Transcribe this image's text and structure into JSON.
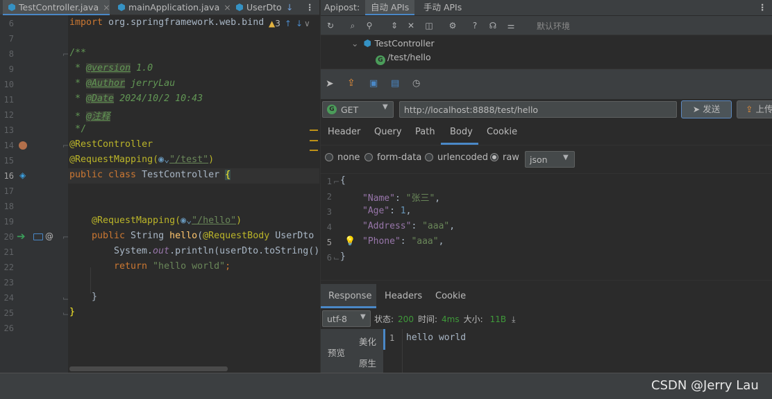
{
  "editor": {
    "tabs": [
      {
        "label": "TestController.java",
        "active": true,
        "closable": true
      },
      {
        "label": "mainApplication.java",
        "active": false,
        "closable": true
      },
      {
        "label": "UserDto",
        "active": false,
        "closable": false
      }
    ],
    "warning_count": "3",
    "line_numbers": [
      "6",
      "7",
      "8",
      "9",
      "10",
      "11",
      "12",
      "13",
      "14",
      "15",
      "16",
      "17",
      "18",
      "19",
      "20",
      "21",
      "22",
      "23",
      "24",
      "25",
      "26"
    ],
    "code": {
      "l6_kw": "import",
      "l6_rest": " org.springframework.web.bind",
      "l8": "/**",
      "l9_star": " * ",
      "l9_tag": "@version",
      "l9_val": " 1.0",
      "l10_tag": "@Author",
      "l10_val": " jerryLau",
      "l11_tag": "@Date",
      "l11_val": " 2024/10/2 10:43",
      "l12_tag": "@注释",
      "l13": " */",
      "l14": "@RestController",
      "l15_ann": "@RequestMapping(",
      "l15_str": "\"/test\"",
      "l15_end": ")",
      "l16_kw": "public class",
      "l16_name": " TestController ",
      "l16_brace": "{",
      "l19_ann": "@RequestMapping(",
      "l19_str": "\"/hello\"",
      "l19_end": ")",
      "l20_kw": "public",
      "l20_type": " String ",
      "l20_fn": "hello",
      "l20_p": "(",
      "l20_ann": "@RequestBody",
      "l20_rest": " UserDto",
      "l21_a": "System.",
      "l21_out": "out",
      "l21_b": ".println(userDto.toString()",
      "l22_kw": "return",
      "l22_str": " \"hello world\"",
      "l22_end": ";",
      "l24": "}",
      "l25": "}"
    }
  },
  "apipost": {
    "header_label": "Apipost:",
    "tabs": [
      "自动 APIs",
      "手动 APIs"
    ],
    "environment": "默认环境",
    "tree": {
      "controller": "TestController",
      "endpoint": "/test/hello",
      "endpoint_method_letter": "G"
    },
    "request": {
      "method": "GET",
      "url": "http://localhost:8888/test/hello",
      "send_label": "发送",
      "upload_label": "上传"
    },
    "param_tabs": [
      "Header",
      "Query",
      "Path",
      "Body",
      "Cookie"
    ],
    "active_param_tab": "Body",
    "body_types": [
      "none",
      "form-data",
      "urlencoded",
      "raw"
    ],
    "selected_body_type": "raw",
    "format": "json",
    "body_lines": [
      "1",
      "2",
      "3",
      "4",
      "5",
      "6"
    ],
    "body": {
      "open": "{",
      "name_key": "\"Name\"",
      "name_val": "\"张三\"",
      "age_key": "\"Age\"",
      "age_val": "1",
      "address_key": "\"Address\"",
      "address_val": "\"aaa\"",
      "phone_key": "\"Phone\"",
      "phone_val": "\"aaa\"",
      "close": "}"
    },
    "response": {
      "tabs": [
        "Response",
        "Headers",
        "Cookie"
      ],
      "encoding": "utf-8",
      "status_label": "状态:",
      "status_value": "200",
      "time_label": "时间:",
      "time_value": "4ms",
      "size_label": "大小:",
      "size_value": "11B",
      "view_label": "预览",
      "pretty_label": "美化",
      "raw_label": "原生",
      "line_number": "1",
      "content": "hello world"
    }
  },
  "watermark": "CSDN @Jerry Lau",
  "colors": {
    "accent": "#4a88c7",
    "green": "#4b9c5a",
    "status_green": "#3f9a3a"
  }
}
